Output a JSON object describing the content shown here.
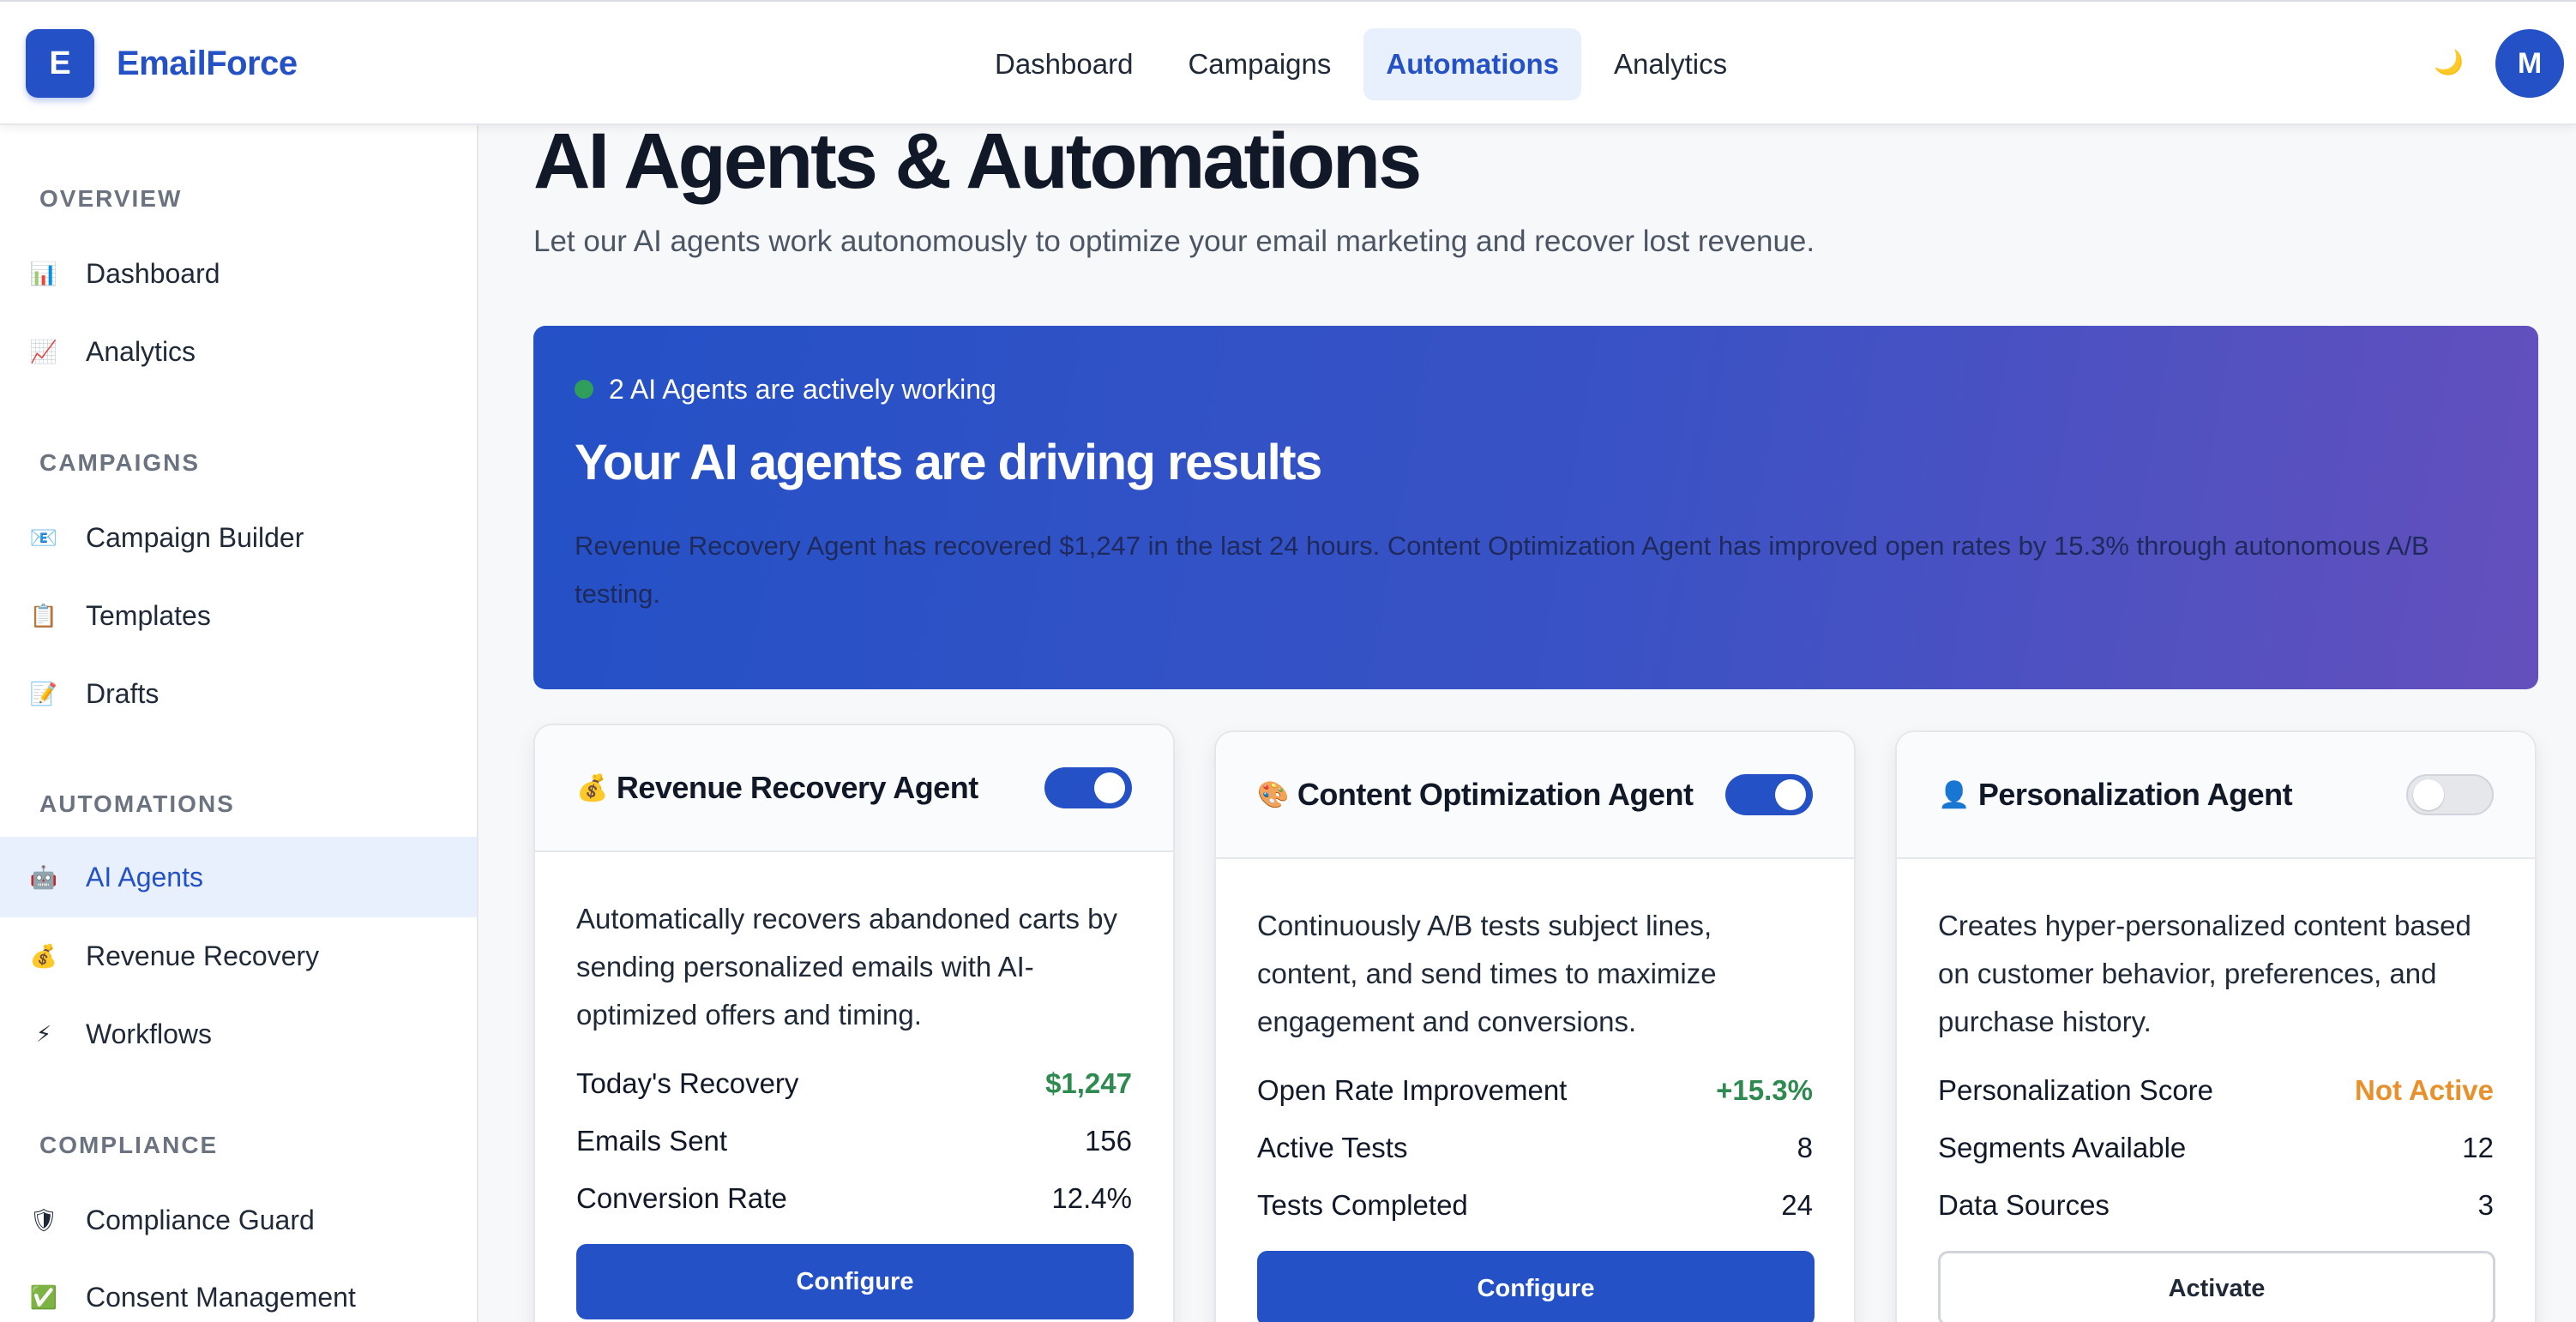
{
  "brand": {
    "logo_letter": "E",
    "name": "EmailForce"
  },
  "nav": {
    "items": [
      {
        "label": "Dashboard"
      },
      {
        "label": "Campaigns"
      },
      {
        "label": "Automations",
        "active": true
      },
      {
        "label": "Analytics"
      }
    ],
    "theme_icon": "🌙",
    "avatar_letter": "M"
  },
  "sidebar": {
    "sections": [
      {
        "title": "OVERVIEW",
        "items": [
          {
            "icon": "📊",
            "icon_name": "bar-chart-icon",
            "label": "Dashboard"
          },
          {
            "icon": "📈",
            "icon_name": "trend-chart-icon",
            "label": "Analytics"
          }
        ]
      },
      {
        "title": "CAMPAIGNS",
        "items": [
          {
            "icon": "📧",
            "icon_name": "email-icon",
            "label": "Campaign Builder"
          },
          {
            "icon": "📋",
            "icon_name": "clipboard-icon",
            "label": "Templates"
          },
          {
            "icon": "📝",
            "icon_name": "memo-icon",
            "label": "Drafts"
          }
        ]
      },
      {
        "title": "AUTOMATIONS",
        "items": [
          {
            "icon": "🤖",
            "icon_name": "robot-icon",
            "label": "AI Agents",
            "active": true
          },
          {
            "icon": "💰",
            "icon_name": "money-bag-icon",
            "label": "Revenue Recovery"
          },
          {
            "icon": "⚡",
            "icon_name": "lightning-icon",
            "label": "Workflows"
          }
        ]
      },
      {
        "title": "COMPLIANCE",
        "items": [
          {
            "icon": "🛡",
            "icon_name": "shield-icon",
            "label": "Compliance Guard"
          },
          {
            "icon": "✅",
            "icon_name": "check-icon",
            "label": "Consent Management"
          }
        ]
      }
    ]
  },
  "main": {
    "title": "AI Agents & Automations",
    "subtitle": "Let our AI agents work autonomously to optimize your email marketing and recover lost revenue.",
    "hero": {
      "status": "2 AI Agents are actively working",
      "title": "Your AI agents are driving results",
      "text": "Revenue Recovery Agent has recovered $1,247 in the last 24 hours. Content Optimization Agent has improved open rates by 15.3% through autonomous A/B testing."
    },
    "cards": [
      {
        "emoji": "💰",
        "title": "Revenue Recovery Agent",
        "enabled": true,
        "description": "Automatically recovers abandoned carts by sending personalized emails with AI-optimized offers and timing.",
        "metrics": [
          {
            "label": "Today's Recovery",
            "value": "$1,247",
            "tone": "green"
          },
          {
            "label": "Emails Sent",
            "value": "156"
          },
          {
            "label": "Conversion Rate",
            "value": "12.4%"
          }
        ],
        "button": "Configure"
      },
      {
        "emoji": "🎨",
        "title": "Content Optimization Agent",
        "enabled": true,
        "description": "Continuously A/B tests subject lines, content, and send times to maximize engagement and conversions.",
        "metrics": [
          {
            "label": "Open Rate Improvement",
            "value": "+15.3%",
            "tone": "green"
          },
          {
            "label": "Active Tests",
            "value": "8"
          },
          {
            "label": "Tests Completed",
            "value": "24"
          }
        ],
        "button": "Configure"
      },
      {
        "emoji": "👤",
        "title": "Personalization Agent",
        "enabled": false,
        "description": "Creates hyper-personalized content based on customer behavior, preferences, and purchase history.",
        "metrics": [
          {
            "label": "Personalization Score",
            "value": "Not Active",
            "tone": "orange"
          },
          {
            "label": "Segments Available",
            "value": "12"
          },
          {
            "label": "Data Sources",
            "value": "3"
          }
        ],
        "button": "Activate"
      }
    ]
  }
}
